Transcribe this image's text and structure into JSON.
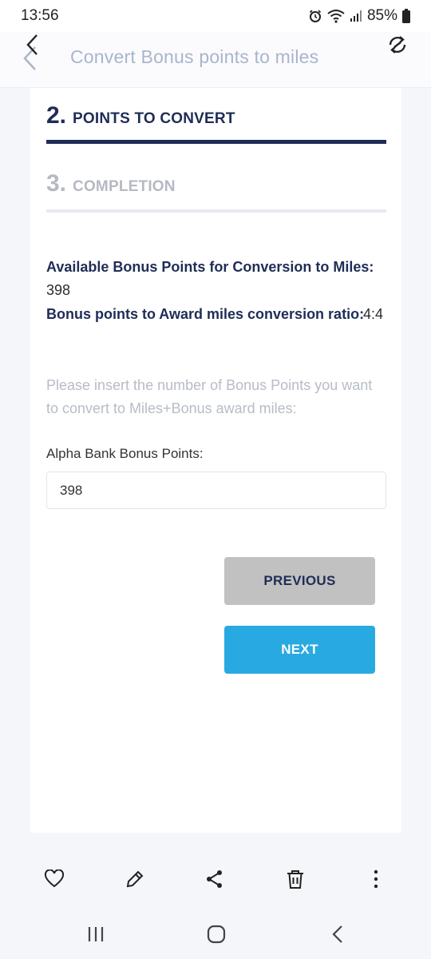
{
  "status_bar": {
    "time": "13:56",
    "battery": "85%",
    "icons": [
      "alarm-icon",
      "wifi-icon",
      "signal-icon",
      "battery-icon"
    ]
  },
  "header": {
    "title": "Convert Bonus points to miles",
    "icons": [
      "back-arrow-icon",
      "refresh-icon"
    ]
  },
  "steps": [
    {
      "number": "2.",
      "label": "POINTS TO CONVERT",
      "state": "active"
    },
    {
      "number": "3.",
      "label": "COMPLETION",
      "state": "inactive"
    }
  ],
  "info": {
    "available_label": "Available Bonus Points for Conversion to Miles:",
    "available_value": "398",
    "ratio_label": "Bonus points to Award miles conversion ratio:",
    "ratio_value": "4:4"
  },
  "instructions": "Please insert the number of Bonus Points you want to convert to Miles+Bonus award miles:",
  "form": {
    "field_label": "Alpha Bank Bonus Points:",
    "field_value": "398"
  },
  "buttons": {
    "previous": "PREVIOUS",
    "next": "NEXT"
  },
  "toolbar": {
    "icons": [
      "heart-icon",
      "edit-icon",
      "share-icon",
      "delete-icon",
      "more-icon"
    ]
  },
  "nav": {
    "icons": [
      "recent-apps-icon",
      "home-icon",
      "back-icon"
    ]
  },
  "colors": {
    "primary": "#1f2d56",
    "accent": "#29a9e1",
    "disabled_button": "#c1c1c1",
    "muted_text": "#b7bcc6"
  }
}
